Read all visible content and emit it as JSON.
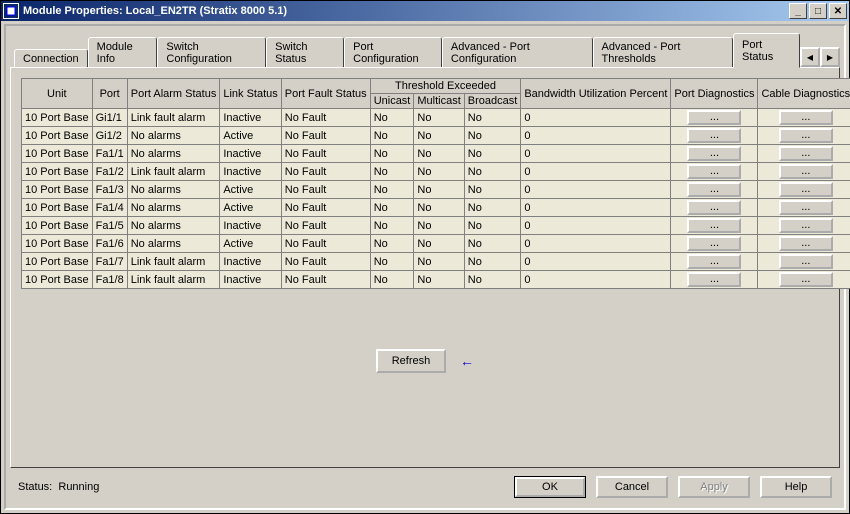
{
  "window": {
    "title": "Module Properties: Local_EN2TR (Stratix 8000 5.1)"
  },
  "tabs": [
    "Connection",
    "Module Info",
    "Switch Configuration",
    "Switch Status",
    "Port Configuration",
    "Advanced - Port Configuration",
    "Advanced - Port Thresholds",
    "Port Status"
  ],
  "active_tab": 7,
  "headers": {
    "unit": "Unit",
    "port": "Port",
    "port_alarm": "Port Alarm Status",
    "link_status": "Link Status",
    "port_fault": "Port Fault Status",
    "thr": "Threshold Exceeded",
    "unicast": "Unicast",
    "multicast": "Multicast",
    "broadcast": "Broadcast",
    "bw": "Bandwidth Utilization Percent",
    "pdiag": "Port Diagnostics",
    "cdiag": "Cable Diagnostics"
  },
  "rows": [
    {
      "unit": "10 Port Base",
      "port": "Gi1/1",
      "alarm": "Link fault alarm",
      "link": "Inactive",
      "fault": "No Fault",
      "u": "No",
      "m": "No",
      "b": "No",
      "bw": "0"
    },
    {
      "unit": "10 Port Base",
      "port": "Gi1/2",
      "alarm": "No alarms",
      "link": "Active",
      "fault": "No Fault",
      "u": "No",
      "m": "No",
      "b": "No",
      "bw": "0"
    },
    {
      "unit": "10 Port Base",
      "port": "Fa1/1",
      "alarm": "No alarms",
      "link": "Inactive",
      "fault": "No Fault",
      "u": "No",
      "m": "No",
      "b": "No",
      "bw": "0"
    },
    {
      "unit": "10 Port Base",
      "port": "Fa1/2",
      "alarm": "Link fault alarm",
      "link": "Inactive",
      "fault": "No Fault",
      "u": "No",
      "m": "No",
      "b": "No",
      "bw": "0"
    },
    {
      "unit": "10 Port Base",
      "port": "Fa1/3",
      "alarm": "No alarms",
      "link": "Active",
      "fault": "No Fault",
      "u": "No",
      "m": "No",
      "b": "No",
      "bw": "0"
    },
    {
      "unit": "10 Port Base",
      "port": "Fa1/4",
      "alarm": "No alarms",
      "link": "Active",
      "fault": "No Fault",
      "u": "No",
      "m": "No",
      "b": "No",
      "bw": "0",
      "hl": true
    },
    {
      "unit": "10 Port Base",
      "port": "Fa1/5",
      "alarm": "No alarms",
      "link": "Inactive",
      "fault": "No Fault",
      "u": "No",
      "m": "No",
      "b": "No",
      "bw": "0"
    },
    {
      "unit": "10 Port Base",
      "port": "Fa1/6",
      "alarm": "No alarms",
      "link": "Active",
      "fault": "No Fault",
      "u": "No",
      "m": "No",
      "b": "No",
      "bw": "0"
    },
    {
      "unit": "10 Port Base",
      "port": "Fa1/7",
      "alarm": "Link fault alarm",
      "link": "Inactive",
      "fault": "No Fault",
      "u": "No",
      "m": "No",
      "b": "No",
      "bw": "0"
    },
    {
      "unit": "10 Port Base",
      "port": "Fa1/8",
      "alarm": "Link fault alarm",
      "link": "Inactive",
      "fault": "No Fault",
      "u": "No",
      "m": "No",
      "b": "No",
      "bw": "0"
    }
  ],
  "refresh_label": "Refresh",
  "status": {
    "label": "Status:",
    "value": "Running"
  },
  "buttons": {
    "ok": "OK",
    "cancel": "Cancel",
    "apply": "Apply",
    "help": "Help",
    "ellipsis": "..."
  }
}
